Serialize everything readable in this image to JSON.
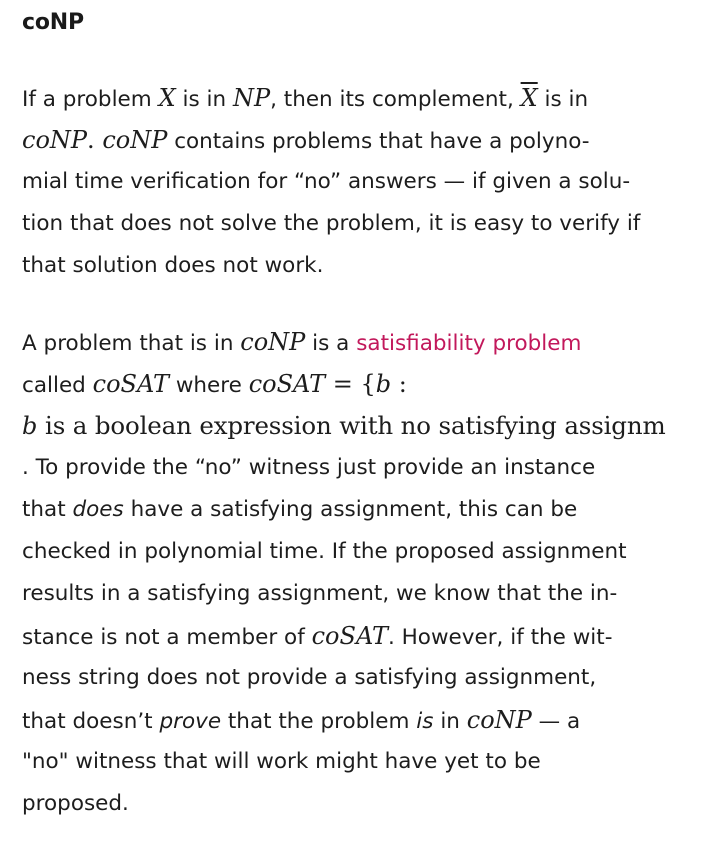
{
  "heading": "coNP",
  "para1": {
    "l1": {
      "a": "If a problem ",
      "x": "X",
      "b": " is in ",
      "np": "NP",
      "c": ", then its complement, ",
      "xbar": "X",
      "d": " is in"
    },
    "l2": {
      "conp1": "coNP",
      "dot": ". ",
      "conp2": "coNP",
      "a": " contains problems that have a polyno-"
    },
    "l3": "mial time verification for “no” answers — if given a solu-",
    "l4": "tion that does not solve the problem, it is easy to verify if",
    "l5": "that solution does not work."
  },
  "para2": {
    "l1": {
      "a": "A problem that is in ",
      "conp": "coNP",
      "b": " is a ",
      "link": "satisfiability problem"
    },
    "l2": {
      "a": "called ",
      "cosat1": "coSAT",
      "b": " where ",
      "cosat2": "coSAT",
      "eq": " = {",
      "bvar": "b",
      "colon": " :"
    },
    "l3": {
      "bvar": "b",
      "rest": " is a boolean expression with no satisfying assignm"
    },
    "l4": ". To provide the “no” witness just provide an instance",
    "l5": {
      "a": "that ",
      "does": "does",
      "b": " have a satisfying assignment, this can be"
    },
    "l6": "checked in polynomial time. If the proposed assignment",
    "l7": "results in a satisfying assignment, we know that the in-",
    "l8": {
      "a": "stance is not a member of ",
      "cosat": "coSAT",
      "b": ". However, if the wit-"
    },
    "l9": "ness string does not provide a satisfying assignment,",
    "l10": {
      "a": "that doesn’t ",
      "prove": "prove",
      "b": " that the problem ",
      "is": "is",
      "c": " in ",
      "conp": "coNP",
      "d": " — a"
    },
    "l11": "\"no\" witness that will work might have yet to be",
    "l12": "proposed."
  }
}
